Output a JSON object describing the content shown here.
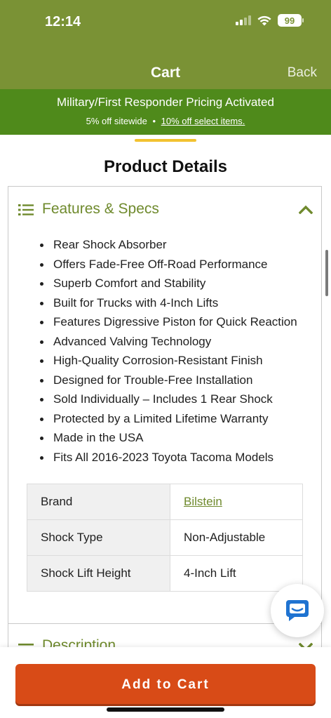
{
  "status_bar": {
    "time": "12:14",
    "battery": "99"
  },
  "nav": {
    "title": "Cart",
    "back_label": "Back"
  },
  "promo": {
    "title": "Military/First Responder Pricing Activated",
    "sitewide": "5% off sitewide",
    "separator": "•",
    "select_link": "10% off select items."
  },
  "section_title": "Product Details",
  "features": {
    "header": "Features & Specs",
    "items": [
      "Rear Shock Absorber",
      "Offers Fade-Free Off-Road Performance",
      "Superb Comfort and Stability",
      "Built for Trucks with 4-Inch Lifts",
      "Features Digressive Piston for Quick Reaction",
      "Advanced Valving Technology",
      "High-Quality Corrosion-Resistant Finish",
      "Designed for Trouble-Free Installation",
      "Sold Individually – Includes 1 Rear Shock",
      "Protected by a Limited Lifetime Warranty",
      "Made in the USA",
      "Fits All 2016-2023 Toyota Tacoma Models"
    ],
    "specs": [
      {
        "label": "Brand",
        "value": "Bilstein"
      },
      {
        "label": "Shock Type",
        "value": "Non-Adjustable"
      },
      {
        "label": "Shock Lift Height",
        "value": "4-Inch Lift"
      }
    ]
  },
  "description": {
    "header": "Description"
  },
  "add_to_cart": "Add to Cart",
  "colors": {
    "nav_bg": "#7a9235",
    "promo_bg": "#4f8a1b",
    "accent_green": "#6f8a2d",
    "button": "#d84b17",
    "tab_indicator": "#f2c230",
    "chat_blue": "#1f73d1"
  },
  "icons": {
    "signal": "cellular-signal-icon",
    "wifi": "wifi-icon",
    "battery": "battery-icon",
    "features": "list-icon",
    "collapse": "chevron-up-icon",
    "description": "menu-lines-icon",
    "expand": "chevron-down-icon",
    "chat": "chat-bubble-icon"
  }
}
